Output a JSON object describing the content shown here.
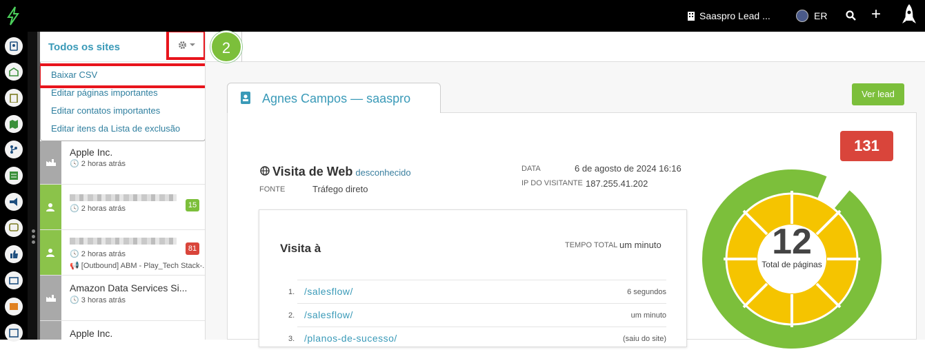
{
  "topbar": {
    "company": "Saaspro Lead ...",
    "user_initials": "ER"
  },
  "sidebar": {
    "title": "Todos os sites",
    "dropdown": [
      "Baixar CSV",
      "Editar páginas importantes",
      "Editar contatos importantes",
      "Editar itens da Lista de exclusão"
    ],
    "rows": [
      {
        "name": "Apple Inc.",
        "time": "2 horas atrás"
      },
      {
        "name": "",
        "time": "2 horas atrás",
        "badge": "15"
      },
      {
        "name": "",
        "time": "2 horas atrás",
        "badge": "81",
        "campaign": "[Outbound] ABM - Play_Tech Stack-..."
      },
      {
        "name": "Amazon Data Services Si...",
        "time": "3 horas atrás"
      },
      {
        "name": "Apple Inc.",
        "time": ""
      }
    ]
  },
  "step_marker": "2",
  "lead": {
    "tab_title": "Agnes Campos — saaspro",
    "view_button": "Ver lead",
    "score": "131",
    "visit_title": "Visita de Web",
    "visit_sub": "desconhecido",
    "source_label": "FONTE",
    "source_value": "Tráfego direto",
    "date_label": "DATA",
    "date_value": "6 de agosto de 2024 16:16",
    "ip_label": "IP DO VISITANTE",
    "ip_value": "187.255.41.202",
    "pages_title": "Visita à",
    "total_time_label": "TEMPO TOTAL",
    "total_time_value": "um minuto",
    "pages": [
      {
        "n": "1.",
        "path": "/salesflow/",
        "time": "6 segundos"
      },
      {
        "n": "2.",
        "path": "/salesflow/",
        "time": "um minuto"
      },
      {
        "n": "3.",
        "path": "/planos-de-sucesso/",
        "time": "(saiu do site)"
      }
    ],
    "total_pages": "12",
    "total_pages_label": "Total de páginas"
  },
  "colors": {
    "accent": "#3a9ab8",
    "green": "#7cbf3b",
    "red": "#d9453b",
    "donut_inner": "#f5c400",
    "highlight": "#e8141c"
  }
}
